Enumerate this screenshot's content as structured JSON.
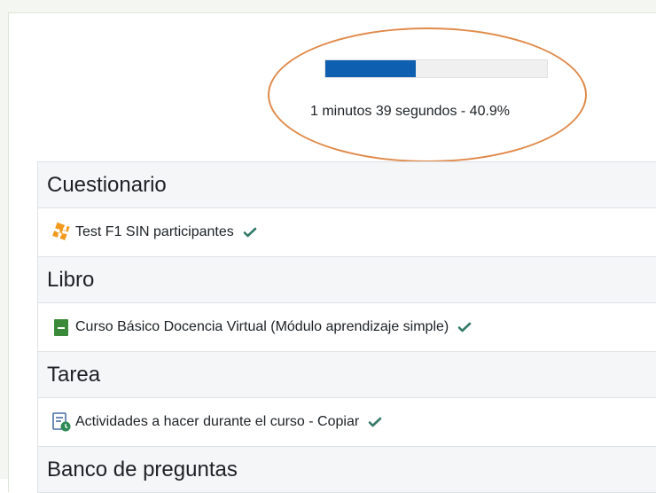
{
  "progress": {
    "percent": 40.9,
    "text": "1 minutos 39 segundos - 40.9%",
    "bar_color": "#0f5fb0",
    "highlight_color": "#e08a4a"
  },
  "sections": [
    {
      "title": "Cuestionario",
      "activities": [
        {
          "name": "Test F1 SIN participantes",
          "icon": "puzzle-icon",
          "completed": true
        }
      ]
    },
    {
      "title": "Libro",
      "activities": [
        {
          "name": "Curso Básico Docencia Virtual (Módulo aprendizaje simple)",
          "icon": "book-icon",
          "completed": true
        }
      ]
    },
    {
      "title": "Tarea",
      "activities": [
        {
          "name": "Actividades a hacer durante el curso - Copiar",
          "icon": "assignment-icon",
          "completed": true
        }
      ]
    },
    {
      "title": "Banco de preguntas",
      "activities": []
    }
  ],
  "colors": {
    "check": "#357a67",
    "section_bg": "#f5f6f8"
  }
}
